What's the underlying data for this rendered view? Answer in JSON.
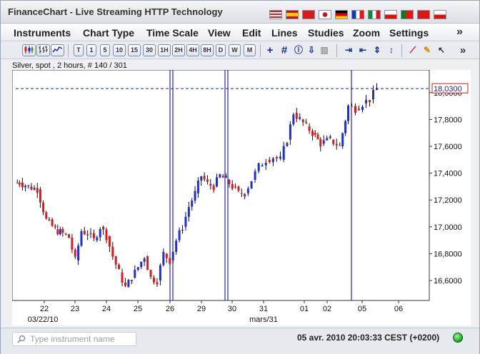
{
  "app": {
    "title": "FinanceChart - Live Streaming HTTP Technology",
    "flags": [
      "us-flag",
      "es-flag",
      "cn-flag",
      "jp-flag",
      "de-flag",
      "fr-flag",
      "it-flag",
      "pl-flag",
      "pt-flag",
      "tr-flag",
      "cz-flag"
    ]
  },
  "menu": {
    "items": [
      "Instruments",
      "Chart Type",
      "Time Scale",
      "View",
      "Edit",
      "Lines",
      "Studies",
      "Zoom",
      "Settings"
    ],
    "more": "»"
  },
  "toolbar": {
    "scale_buttons": [
      "T",
      "1",
      "5",
      "10",
      "15",
      "30",
      "1H",
      "2H",
      "4H",
      "8H",
      "D",
      "W",
      "M"
    ],
    "more": "»"
  },
  "chart_caption": "Silver, spot , 2 hours, # 140 / 301",
  "chart_data": {
    "type": "candlestick",
    "instrument": "Silver, spot",
    "interval": "2 hours",
    "ylim": [
      16.45,
      18.1
    ],
    "yticks": [
      "18,0000",
      "17,8000",
      "17,6000",
      "17,4000",
      "17,2000",
      "17,0000",
      "16,8000",
      "16,6000"
    ],
    "ytick_values": [
      18.0,
      17.8,
      17.6,
      17.4,
      17.2,
      17.0,
      16.8,
      16.6
    ],
    "xticks": [
      "22",
      "23",
      "24",
      "25",
      "26",
      "29",
      "30",
      "31",
      "01",
      "02",
      "05",
      "06"
    ],
    "xsublabels": [
      "03/22/10",
      "mars/31"
    ],
    "current_price": 18.03,
    "current_price_label": "18,0300",
    "vertical_markers": [
      "26",
      "30",
      "04/02"
    ],
    "colors": {
      "up": "#1d2fd8",
      "down": "#e01818",
      "price_line": "#1a2a8a",
      "marker": "#2222cc"
    },
    "close_path": [
      [
        "22",
        17.33
      ],
      [
        "22",
        17.3
      ],
      [
        "22",
        17.28
      ],
      [
        "22",
        17.05
      ],
      [
        "22",
        16.98
      ],
      [
        "23",
        16.95
      ],
      [
        "23",
        16.92
      ],
      [
        "23",
        16.75
      ],
      [
        "23",
        16.97
      ],
      [
        "23",
        16.95
      ],
      [
        "24",
        16.9
      ],
      [
        "24",
        17.0
      ],
      [
        "24",
        16.93
      ],
      [
        "24",
        16.78
      ],
      [
        "24",
        16.66
      ],
      [
        "25",
        16.55
      ],
      [
        "25",
        16.62
      ],
      [
        "25",
        16.7
      ],
      [
        "25",
        16.78
      ],
      [
        "25",
        16.62
      ],
      [
        "26",
        16.6
      ],
      [
        "26",
        16.8
      ],
      [
        "26",
        16.75
      ],
      [
        "26",
        16.9
      ],
      [
        "26",
        17.0
      ],
      [
        "29",
        17.15
      ],
      [
        "29",
        17.25
      ],
      [
        "29",
        17.38
      ],
      [
        "29",
        17.32
      ],
      [
        "29",
        17.3
      ],
      [
        "30",
        17.38
      ],
      [
        "30",
        17.35
      ],
      [
        "30",
        17.3
      ],
      [
        "30",
        17.25
      ],
      [
        "30",
        17.25
      ],
      [
        "31",
        17.35
      ],
      [
        "31",
        17.45
      ],
      [
        "31",
        17.5
      ],
      [
        "31",
        17.52
      ],
      [
        "31",
        17.5
      ],
      [
        "01",
        17.65
      ],
      [
        "01",
        17.85
      ],
      [
        "01",
        17.8
      ],
      [
        "01",
        17.75
      ],
      [
        "01",
        17.7
      ],
      [
        "02",
        17.62
      ],
      [
        "02",
        17.65
      ],
      [
        "02",
        17.6
      ],
      [
        "05",
        17.9
      ],
      [
        "05",
        17.88
      ],
      [
        "05",
        17.92
      ],
      [
        "05",
        17.95
      ],
      [
        "05",
        18.03
      ]
    ]
  },
  "status": {
    "search_placeholder": "Type instrument name",
    "datetime": "05 avr. 2010 20:03:33",
    "timezone": "CEST (+0200)",
    "datetime_full": "05 avr. 2010 20:03:33  CEST (+0200)"
  }
}
